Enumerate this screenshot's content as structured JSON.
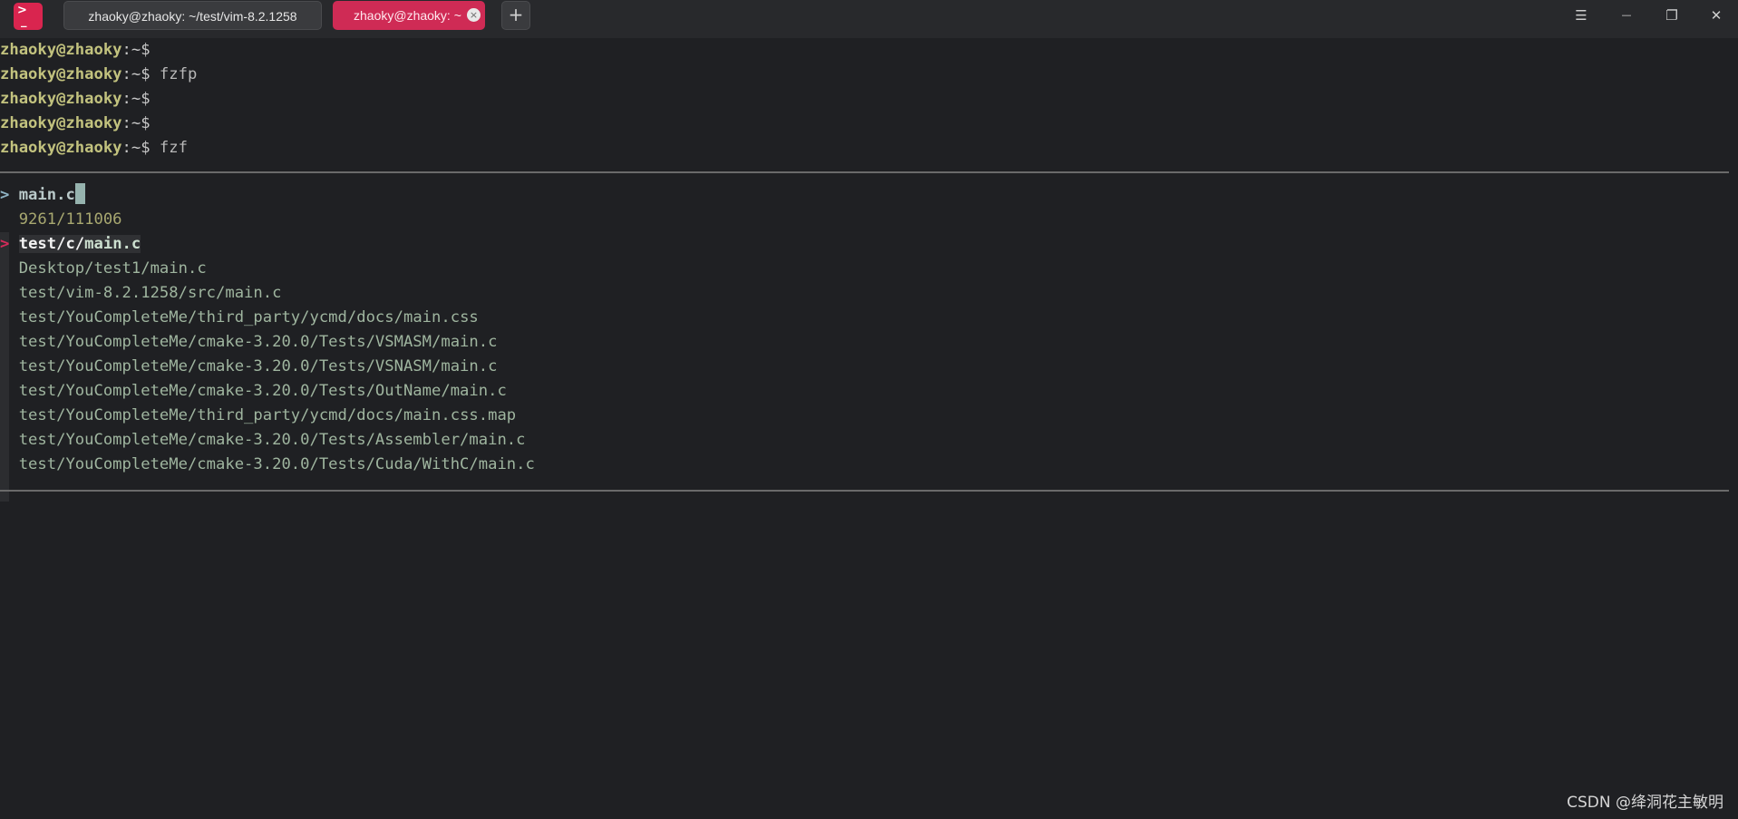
{
  "titlebar": {
    "app_icon_glyph": ">",
    "app_icon_underscore": "_",
    "tabs": [
      {
        "label": "zhaoky@zhaoky: ~/test/vim-8.2.1258"
      },
      {
        "label": "zhaoky@zhaoky: ~"
      }
    ],
    "tab_close_glyph": "×",
    "new_tab_glyph": "+",
    "window_buttons": {
      "menu": "☰",
      "minimize": "—",
      "maximize": "❐",
      "close": "✕"
    }
  },
  "terminal": {
    "history": [
      {
        "user": "zhaoky@zhaoky",
        "sep": ":~$",
        "cmd": ""
      },
      {
        "user": "zhaoky@zhaoky",
        "sep": ":~$",
        "cmd": " fzfp"
      },
      {
        "user": "zhaoky@zhaoky",
        "sep": ":~$",
        "cmd": ""
      },
      {
        "user": "zhaoky@zhaoky",
        "sep": ":~$",
        "cmd": ""
      },
      {
        "user": "zhaoky@zhaoky",
        "sep": ":~$",
        "cmd": " fzf"
      }
    ],
    "fzf": {
      "prompt": "> ",
      "query": "main.c",
      "count": "9261/111006",
      "pointer": ">",
      "selected": {
        "prefix": "test/c/",
        "match": "main.c"
      },
      "results": [
        {
          "prefix": "Desktop/test1/",
          "match": "main.c",
          "suffix": ""
        },
        {
          "prefix": "test/vim-8.2.1258/src/",
          "match": "main.c",
          "suffix": ""
        },
        {
          "prefix": "test/YouCompleteMe/third_party/ycmd/docs/",
          "match": "main.c",
          "suffix": "ss"
        },
        {
          "prefix": "test/YouCompleteMe/cmake-3.20.0/Tests/VSMASM/",
          "match": "main.c",
          "suffix": ""
        },
        {
          "prefix": "test/YouCompleteMe/cmake-3.20.0/Tests/VSNASM/",
          "match": "main.c",
          "suffix": ""
        },
        {
          "prefix": "test/YouCompleteMe/cmake-3.20.0/Tests/OutName/",
          "match": "main.c",
          "suffix": ""
        },
        {
          "prefix": "test/YouCompleteMe/third_party/ycmd/docs/",
          "match": "main.c",
          "suffix": "ss.map"
        },
        {
          "prefix": "test/YouCompleteMe/cmake-3.20.0/Tests/Assembler/",
          "match": "main.c",
          "suffix": ""
        },
        {
          "prefix": "test/YouCompleteMe/cmake-3.20.0/Tests/Cuda/WithC/",
          "match": "main.c",
          "suffix": ""
        }
      ]
    }
  },
  "watermark": "CSDN @绛洞花主敏明"
}
